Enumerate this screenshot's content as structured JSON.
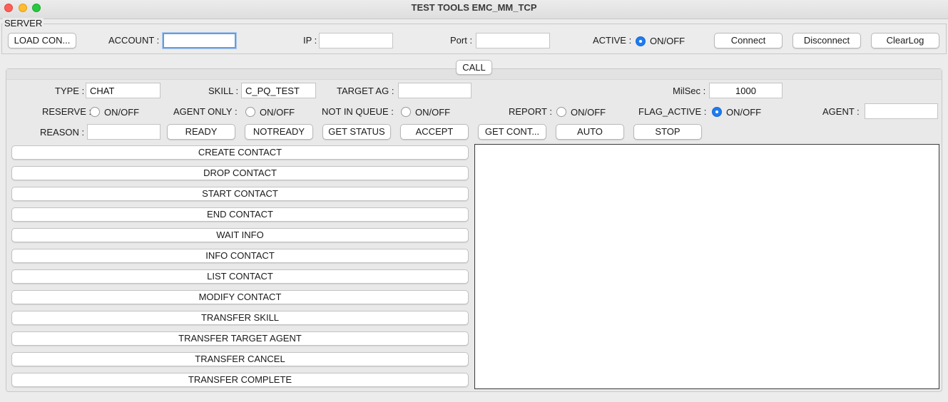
{
  "window": {
    "title": "TEST TOOLS EMC_MM_TCP"
  },
  "server": {
    "legend": "SERVER",
    "load_label": "LOAD CON...",
    "account_label": "ACCOUNT :",
    "account_value": "",
    "ip_label": "IP :",
    "ip_value": "",
    "port_label": "Port :",
    "port_value": "",
    "active_label": "ACTIVE :",
    "active_toggle": "ON/OFF",
    "connect_label": "Connect",
    "disconnect_label": "Disconnect",
    "clearlog_label": "ClearLog"
  },
  "call": {
    "tab_label": "CALL",
    "type_label": "TYPE :",
    "type_value": "CHAT",
    "skill_label": "SKILL :",
    "skill_value": "C_PQ_TEST",
    "target_ag_label": "TARGET AG :",
    "target_ag_value": "",
    "milsec_label": "MilSec :",
    "milsec_value": "1000",
    "reserve_label": "RESERVE :",
    "agent_only_label": "AGENT ONLY :",
    "not_in_queue_label": "NOT IN QUEUE :",
    "report_label": "REPORT :",
    "flag_active_label": "FLAG_ACTIVE :",
    "agent_label": "AGENT :",
    "agent_value": "",
    "toggle_text": "ON/OFF",
    "reason_label": "REASON :",
    "reason_value": "",
    "ready_label": "READY",
    "notready_label": "NOTREADY",
    "get_status_label": "GET STATUS",
    "accept_label": "ACCEPT",
    "get_cont_label": "GET CONT...",
    "auto_label": "AUTO",
    "stop_label": "STOP"
  },
  "actions": [
    "CREATE CONTACT",
    "DROP CONTACT",
    "START CONTACT",
    "END CONTACT",
    "WAIT INFO",
    "INFO CONTACT",
    "LIST CONTACT",
    "MODIFY CONTACT",
    "TRANSFER SKILL",
    "TRANSFER TARGET AGENT",
    "TRANSFER CANCEL",
    "TRANSFER COMPLETE"
  ],
  "radios": {
    "active": true,
    "reserve": false,
    "agent_only": false,
    "not_in_queue": false,
    "report": false,
    "flag_active": true
  },
  "colors": {
    "accent": "#1e7cf0",
    "close": "#fe5f57",
    "minimize": "#febc2e",
    "zoom": "#28c840"
  }
}
